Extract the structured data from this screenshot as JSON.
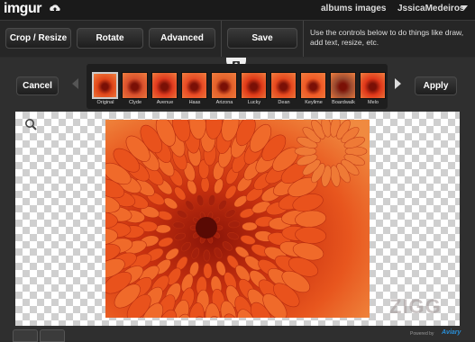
{
  "header": {
    "logo": "imgur",
    "upload_icon": "upload-cloud-icon",
    "nav": {
      "albums": "albums",
      "images": "images",
      "user": "JssicaMedeiros"
    }
  },
  "toolbar": {
    "crop_label": "Crop / Resize",
    "rotate_label": "Rotate",
    "advanced_label": "Advanced",
    "save_label": "Save",
    "help_text": "Use the controls below to do things like draw, add text, resize, etc."
  },
  "editor": {
    "cancel_label": "Cancel",
    "apply_label": "Apply",
    "filters": [
      {
        "label": "Original",
        "selected": true,
        "color": "#e0461a"
      },
      {
        "label": "Clyde",
        "selected": false,
        "color": "#d9502c"
      },
      {
        "label": "Avenue",
        "selected": false,
        "color": "#e03a1e"
      },
      {
        "label": "Haas",
        "selected": false,
        "color": "#e84a24"
      },
      {
        "label": "Arizona",
        "selected": false,
        "color": "#e4602a"
      },
      {
        "label": "Lucky",
        "selected": false,
        "color": "#e03a18"
      },
      {
        "label": "Dean",
        "selected": false,
        "color": "#e6481e"
      },
      {
        "label": "Keylime",
        "selected": false,
        "color": "#f05a26"
      },
      {
        "label": "Boardwalk",
        "selected": false,
        "color": "#9a4a30"
      },
      {
        "label": "Melo",
        "selected": false,
        "color": "#e0381a"
      }
    ],
    "footer": {
      "powered_by": "Powered by",
      "brand": "Aviary"
    },
    "watermark": "ZIGG"
  },
  "colors": {
    "accent": "#2a8fd8",
    "photo": "#d84a1c"
  }
}
